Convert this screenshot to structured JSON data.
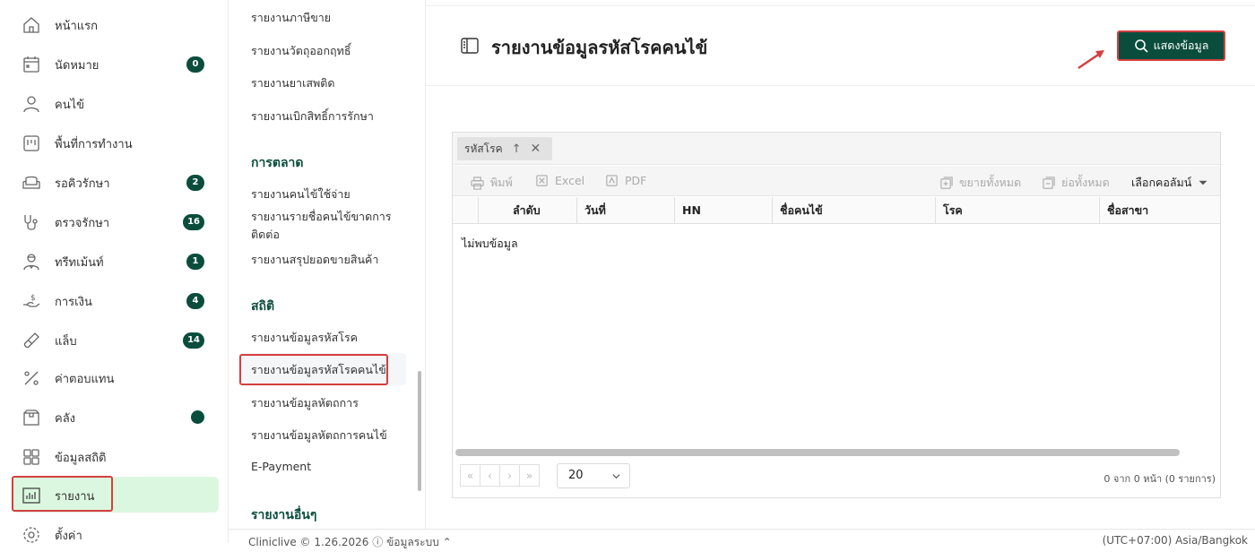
{
  "nav": {
    "items": [
      {
        "label": "หน้าแรก",
        "icon": "home-icon"
      },
      {
        "label": "นัดหมาย",
        "icon": "calendar-icon",
        "badge": "0"
      },
      {
        "label": "คนไข้",
        "icon": "user-icon"
      },
      {
        "label": "พื้นที่การทำงาน",
        "icon": "workspace-icon"
      },
      {
        "label": "รอคิวรักษา",
        "icon": "sofa-icon",
        "badge": "2"
      },
      {
        "label": "ตรวจรักษา",
        "icon": "stethoscope-icon",
        "badge": "16"
      },
      {
        "label": "ทรีทเม้นท์",
        "icon": "doctor-icon",
        "badge": "1"
      },
      {
        "label": "การเงิน",
        "icon": "money-hand-icon",
        "badge": "4"
      },
      {
        "label": "แล็บ",
        "icon": "test-tube-icon",
        "badge": "14"
      },
      {
        "label": "ค่าตอบแทน",
        "icon": "percent-icon"
      },
      {
        "label": "คลัง",
        "icon": "box-icon",
        "dot": true
      },
      {
        "label": "ข้อมูลสถิติ",
        "icon": "grid-icon"
      },
      {
        "label": "รายงาน",
        "icon": "report-chart-icon",
        "active": true
      },
      {
        "label": "ตั้งค่า",
        "icon": "gear-icon"
      }
    ]
  },
  "submenu": {
    "items_top": [
      "รายงานภาษีขาย",
      "รายงานวัตถุออกฤทธิ์",
      "รายงานยาเสพติด",
      "รายงานเบิกสิทธิ์การรักษา"
    ],
    "section_marketing": "การตลาด",
    "items_marketing": [
      "รายงานคนไข้ใช้จ่าย",
      "รายงานรายชื่อคนไข้ขาดการติดต่อ",
      "รายงานสรุปยอดขายสินค้า"
    ],
    "section_stats": "สถิติ",
    "items_stats": [
      "รายงานข้อมูลรหัสโรค",
      "รายงานข้อมูลรหัสโรคคนไข้",
      "รายงานข้อมูลหัตถการ",
      "รายงานข้อมูลหัตถการคนไข้",
      "E-Payment"
    ],
    "section_other": "รายงานอื่นๆ"
  },
  "main": {
    "title": "รายงานข้อมูลรหัสโรคคนไข้",
    "show_button": "แสดงข้อมูล",
    "group_chip": "รหัสโรค",
    "toolbar": {
      "print": "พิมพ์",
      "excel": "Excel",
      "pdf": "PDF",
      "expand_all": "ขยายทั้งหมด",
      "collapse_all": "ย่อทั้งหมด",
      "choose_columns": "เลือกคอลัมน์"
    },
    "columns": [
      "ลำดับ",
      "วันที่",
      "HN",
      "ชื่อคนไข้",
      "โรค",
      "ชื่อสาขา"
    ],
    "empty_text": "ไม่พบข้อมูล",
    "page_size": "20",
    "page_info": "0 จาก 0 หน้า (0 รายการ)"
  },
  "footer": {
    "left": "Cliniclive © 1.26.2026   ⓘ ข้อมูลระบบ ⌃",
    "right": "(UTC+07:00) Asia/Bangkok"
  },
  "colors": {
    "brand": "#0b4d3c",
    "highlight": "#d43f3f",
    "active_bg": "#dcf7df"
  }
}
